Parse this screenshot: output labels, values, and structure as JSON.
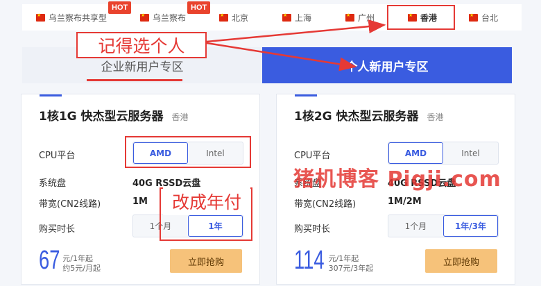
{
  "regions": [
    {
      "name": "乌兰察布共享型",
      "hot": true
    },
    {
      "name": "乌兰察布",
      "hot": true
    },
    {
      "name": "北京",
      "hot": false
    },
    {
      "name": "上海",
      "hot": false
    },
    {
      "name": "广州",
      "hot": false
    },
    {
      "name": "香港",
      "hot": false,
      "active": true
    },
    {
      "name": "台北",
      "hot": false
    }
  ],
  "hot_label": "HOT",
  "section_tabs": {
    "company": "企业新用户专区",
    "personal": "个人新用户专区"
  },
  "annotations": {
    "choose_personal": "记得选个人",
    "change_yearly": "改成年付",
    "watermark": "猪机博客 Pigji.com"
  },
  "labels": {
    "cpu": "CPU平台",
    "disk": "系统盘",
    "bandwidth": "带宽(CN2线路)",
    "duration": "购买时长",
    "buy": "立即抢购"
  },
  "cards": [
    {
      "title": "1核1G 快杰型云服务器",
      "region": "香港",
      "cpu_options": [
        "AMD",
        "Intel"
      ],
      "cpu_selected": "AMD",
      "disk": "40G RSSD云盘",
      "bandwidth": "1M",
      "duration_options": [
        "1个月",
        "1年"
      ],
      "duration_selected": "1年",
      "price": "67",
      "price_unit": "元/1年起",
      "price_sub": "约5元/月起"
    },
    {
      "title": "1核2G 快杰型云服务器",
      "region": "香港",
      "cpu_options": [
        "AMD",
        "Intel"
      ],
      "cpu_selected": "AMD",
      "disk": "40G RSSD云盘",
      "bandwidth": "1M/2M",
      "duration_options": [
        "1个月",
        "1年/3年"
      ],
      "duration_selected": "1年/3年",
      "price": "114",
      "price_unit": "元/1年起",
      "price_sub": "307元/3年起"
    }
  ],
  "colors": {
    "accent": "#3a5ce0",
    "annotation_red": "#e53935",
    "buy_button": "#f6c27a"
  }
}
